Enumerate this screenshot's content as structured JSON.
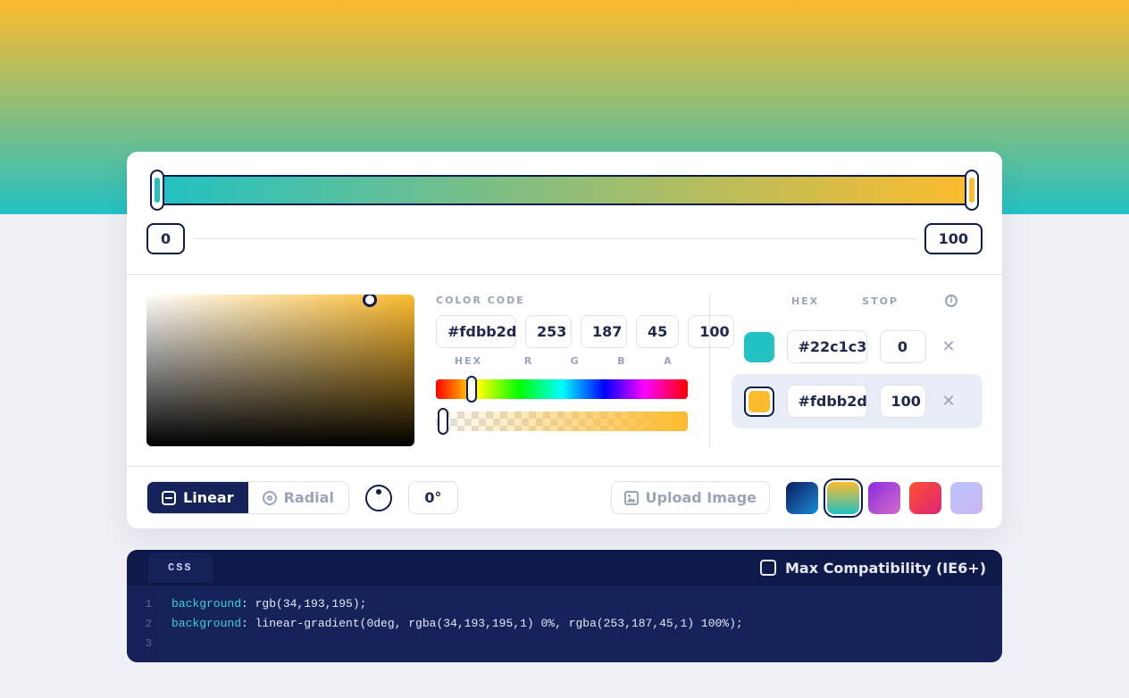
{
  "gradient": {
    "stopA": {
      "hex": "#22c1c3",
      "stop": 0
    },
    "stopB": {
      "hex": "#fdbb2d",
      "stop": 100
    },
    "selected": "B"
  },
  "stops_row": {
    "left": "0",
    "right": "100"
  },
  "color_code": {
    "heading": "COLOR CODE",
    "hex": "#fdbb2d",
    "r": "253",
    "g": "187",
    "b": "45",
    "a": "100",
    "labels": {
      "hex": "HEX",
      "r": "R",
      "g": "G",
      "b": "B",
      "a": "A"
    }
  },
  "right": {
    "hex_label": "HEX",
    "stop_label": "STOP",
    "rows": [
      {
        "color": "#22c1c3",
        "hex": "#22c1c3",
        "stop": "0"
      },
      {
        "color": "#fdbb2d",
        "hex": "#fdbb2d",
        "stop": "100"
      }
    ]
  },
  "tabs": {
    "linear": "Linear",
    "radial": "Radial",
    "degrees": "0°"
  },
  "upload_label": "Upload Image",
  "presets": [
    {
      "bg": "linear-gradient(135deg,#0a1a5e,#1b8bd6)"
    },
    {
      "bg": "linear-gradient(0deg,#22c1c3,#fdbb2d)",
      "selected": true
    },
    {
      "bg": "linear-gradient(135deg,#8a2be2,#d36bc6)"
    },
    {
      "bg": "linear-gradient(135deg,#ff512f,#dd2476)"
    },
    {
      "bg": "linear-gradient(135deg,#b8c6ff,#cdb4f0)"
    }
  ],
  "code": {
    "tab": "CSS",
    "compat": "Max Compatibility (IE6+)",
    "lines": [
      {
        "n": "1",
        "kw": "background",
        "rest": ": rgb(34,193,195);"
      },
      {
        "n": "2",
        "kw": "background",
        "rest": ": linear-gradient(0deg, rgba(34,193,195,1) 0%, rgba(253,187,45,1) 100%);"
      },
      {
        "n": "3",
        "kw": "",
        "rest": ""
      }
    ]
  }
}
